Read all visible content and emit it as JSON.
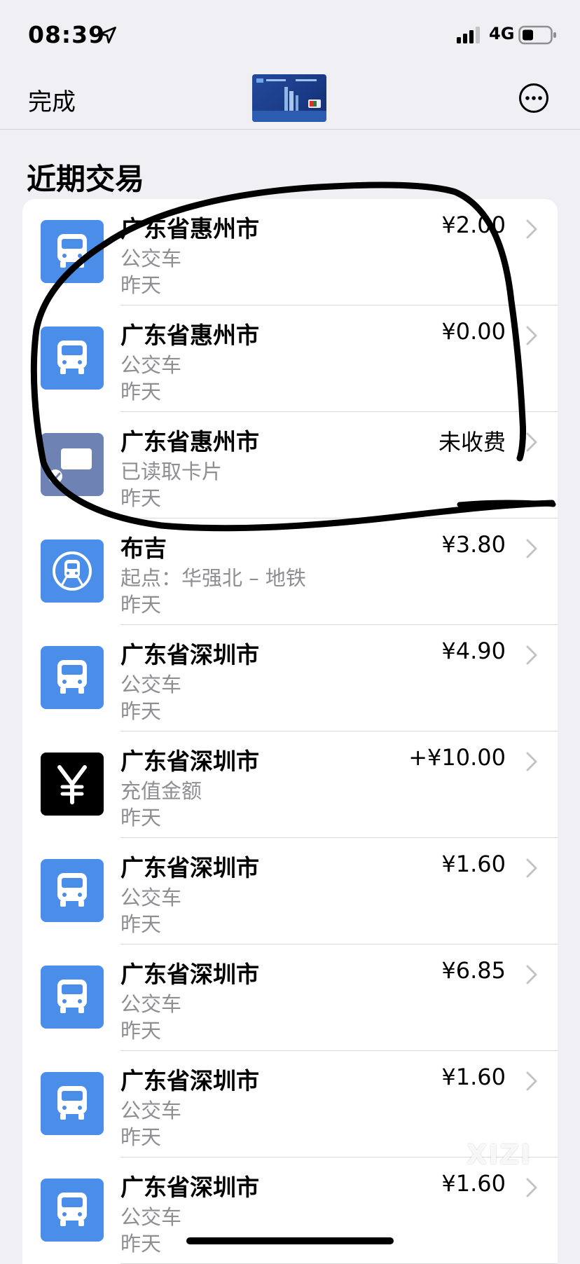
{
  "status_bar": {
    "time": "08:39",
    "network": "4G"
  },
  "nav": {
    "done_label": "完成",
    "more_icon": "ellipsis-circle-icon"
  },
  "section": {
    "title": "近期交易"
  },
  "transactions": [
    {
      "title": "广东省惠州市",
      "subtitle": "公交车",
      "date": "昨天",
      "amount": "¥2.00",
      "icon": "bus-icon",
      "icon_bg": "#4a8ee9"
    },
    {
      "title": "广东省惠州市",
      "subtitle": "公交车",
      "date": "昨天",
      "amount": "¥0.00",
      "icon": "bus-icon",
      "icon_bg": "#4a8ee9"
    },
    {
      "title": "广东省惠州市",
      "subtitle": "已读取卡片",
      "date": "昨天",
      "amount": "未收费",
      "icon": "card-read-icon",
      "icon_bg": "#6f82b4"
    },
    {
      "title": "布吉",
      "subtitle": "起点：华强北 – 地铁",
      "date": "昨天",
      "amount": "¥3.80",
      "icon": "metro-icon",
      "icon_bg": "#4a8ee9"
    },
    {
      "title": "广东省深圳市",
      "subtitle": "公交车",
      "date": "昨天",
      "amount": "¥4.90",
      "icon": "bus-icon",
      "icon_bg": "#4a8ee9"
    },
    {
      "title": "广东省深圳市",
      "subtitle": "充值金额",
      "date": "昨天",
      "amount": "+¥10.00",
      "icon": "yuan-icon",
      "icon_bg": "#000000"
    },
    {
      "title": "广东省深圳市",
      "subtitle": "公交车",
      "date": "昨天",
      "amount": "¥1.60",
      "icon": "bus-icon",
      "icon_bg": "#4a8ee9"
    },
    {
      "title": "广东省深圳市",
      "subtitle": "公交车",
      "date": "昨天",
      "amount": "¥6.85",
      "icon": "bus-icon",
      "icon_bg": "#4a8ee9"
    },
    {
      "title": "广东省深圳市",
      "subtitle": "公交车",
      "date": "昨天",
      "amount": "¥1.60",
      "icon": "bus-icon",
      "icon_bg": "#4a8ee9"
    },
    {
      "title": "广东省深圳市",
      "subtitle": "公交车",
      "date": "昨天",
      "amount": "¥1.60",
      "icon": "bus-icon",
      "icon_bg": "#4a8ee9"
    }
  ],
  "watermark": "XIZI",
  "colors": {
    "background": "#efeff4",
    "accent_blue": "#4a8ee9",
    "secondary_text": "#8e8e93",
    "annotation_stroke": "#000000"
  }
}
